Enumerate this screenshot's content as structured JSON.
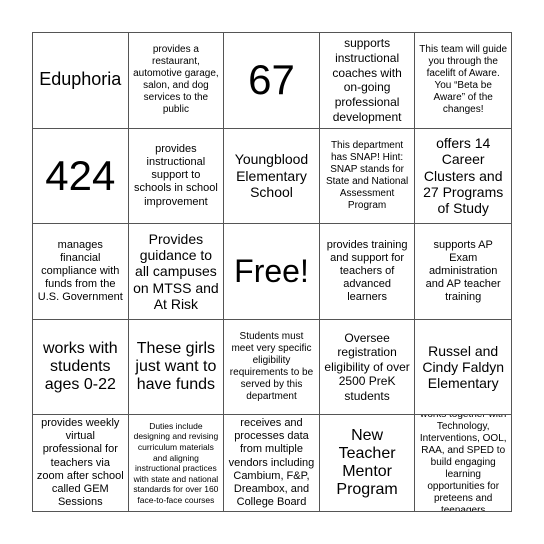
{
  "board": {
    "cells": [
      {
        "text": "Eduphoria"
      },
      {
        "text": "provides a restaurant, automotive garage, salon, and dog services to the public"
      },
      {
        "text": "67"
      },
      {
        "text": "supports instructional coaches with on-going professional development"
      },
      {
        "text": "This team will guide you through the facelift of Aware. You “Beta be Aware” of the changes!"
      },
      {
        "text": "424"
      },
      {
        "text": "provides instructional support to schools in school improvement"
      },
      {
        "text": "Youngblood Elementary School"
      },
      {
        "text": "This department has SNAP! Hint: SNAP stands for State and National Assessment Program"
      },
      {
        "text": "offers 14 Career Clusters and 27 Programs of Study"
      },
      {
        "text": "manages financial compliance with funds from the U.S. Government"
      },
      {
        "text": "Provides guidance to all campuses on MTSS and At Risk"
      },
      {
        "text": "Free!"
      },
      {
        "text": "provides training and support for teachers of advanced learners"
      },
      {
        "text": "supports AP Exam administration and AP teacher training"
      },
      {
        "text": "works with students ages 0-22"
      },
      {
        "text": "These girls just want to have funds"
      },
      {
        "text": "Students must meet very specific eligibility requirements to be served by this department"
      },
      {
        "text": "Oversee registration eligibility of over 2500 PreK students"
      },
      {
        "text": "Russel and Cindy Faldyn Elementary"
      },
      {
        "text": "provides weekly virtual professional for teachers via zoom after school called GEM Sessions"
      },
      {
        "text": "Duties include designing and revising curriculum materials and aligning instructional practices with state and national standards for over 160 face-to-face courses"
      },
      {
        "text": "receives and processes data from multiple vendors including Cambium, F&P, Dreambox, and College Board"
      },
      {
        "text": "New Teacher Mentor Program"
      },
      {
        "text": "works together with Technology, Interventions, OOL, RAA, and SPED to build engaging learning opportunities for preteens and teenagers"
      }
    ]
  }
}
